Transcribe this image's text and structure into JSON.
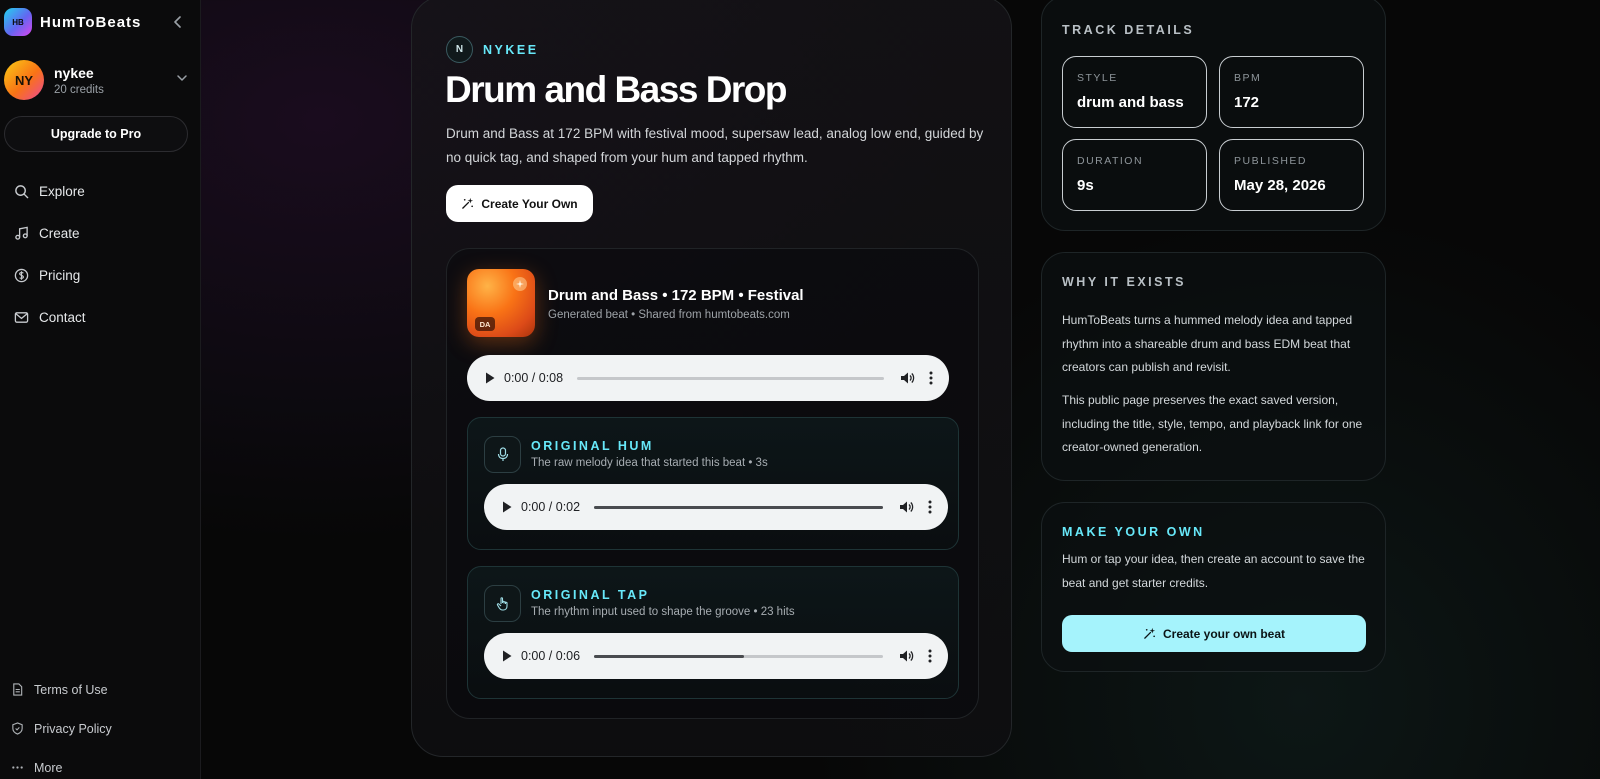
{
  "brand": {
    "logo_text": "HB",
    "name": "HumToBeats"
  },
  "user": {
    "initials": "NY",
    "name": "nykee",
    "credits": "20 credits"
  },
  "sidebar": {
    "upgrade_label": "Upgrade to Pro",
    "nav": [
      {
        "label": "Explore",
        "icon": "search-icon"
      },
      {
        "label": "Create",
        "icon": "music-note-icon"
      },
      {
        "label": "Pricing",
        "icon": "dollar-circle-icon"
      },
      {
        "label": "Contact",
        "icon": "mail-icon"
      }
    ],
    "footer": [
      {
        "label": "Terms of Use",
        "icon": "document-icon"
      },
      {
        "label": "Privacy Policy",
        "icon": "shield-icon"
      },
      {
        "label": "More",
        "icon": "more-horizontal-icon"
      }
    ]
  },
  "main": {
    "artist_initial": "N",
    "artist_name": "NYKEE",
    "title": "Drum and Bass Drop",
    "description": "Drum and Bass at 172 BPM with festival mood, supersaw lead, analog low end, guided by no quick tag, and shaped from your hum and tapped rhythm.",
    "create_own_label": "Create Your Own",
    "track": {
      "cover_tag": "DA",
      "title": "Drum and Bass • 172 BPM • Festival",
      "subtitle": "Generated beat • Shared from humtobeats.com",
      "player_time": "0:00 / 0:08",
      "progress": 0
    },
    "original_hum": {
      "title": "ORIGINAL HUM",
      "subtitle": "The raw melody idea that started this beat • 3s",
      "player_time": "0:00 / 0:02",
      "progress": 1.0
    },
    "original_tap": {
      "title": "ORIGINAL TAP",
      "subtitle": "The rhythm input used to shape the groove • 23 hits",
      "player_time": "0:00 / 0:06",
      "progress": 0.52
    }
  },
  "details": {
    "heading": "TRACK DETAILS",
    "style_label": "STYLE",
    "style_value": "drum and bass",
    "bpm_label": "BPM",
    "bpm_value": "172",
    "duration_label": "DURATION",
    "duration_value": "9s",
    "published_label": "PUBLISHED",
    "published_value": "May 28, 2026"
  },
  "why": {
    "heading": "WHY IT EXISTS",
    "p1": "HumToBeats turns a hummed melody idea and tapped rhythm into a shareable drum and bass EDM beat that creators can publish and revisit.",
    "p2": "This public page preserves the exact saved version, including the title, style, tempo, and playback link for one creator-owned generation."
  },
  "make": {
    "heading": "MAKE YOUR OWN",
    "text": "Hum or tap your idea, then create an account to save the beat and get starter credits.",
    "cta_label": "Create your own beat"
  },
  "colors": {
    "accent_cyan": "#67e8f9",
    "cta_bg": "#a5f3fc",
    "cover_orange": "#f97316"
  }
}
